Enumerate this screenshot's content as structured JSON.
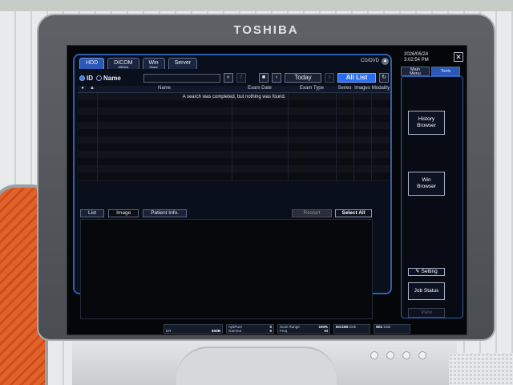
{
  "monitor": {
    "brand": "TOSHIBA"
  },
  "tabs": [
    {
      "label": "HDD",
      "active": true
    },
    {
      "label": "DICOM",
      "sub": "MEDIA"
    },
    {
      "label": "Win",
      "sub": "Share"
    },
    {
      "label": "Server"
    }
  ],
  "cd_label": "CD/DVD",
  "search": {
    "id_label": "ID",
    "name_label": "Name",
    "today_label": "Today",
    "all_list_label": "All List"
  },
  "list": {
    "columns": [
      "Name",
      "Exam Date",
      "Exam Type",
      "Series",
      "Images",
      "Modality"
    ],
    "message": "A search was completed, but nothing was found."
  },
  "lower": {
    "tabs": [
      "List",
      "Image",
      "Patient Info."
    ],
    "restart_label": "Restart",
    "select_all_label": "Select All"
  },
  "side": {
    "date": "2026/06/24",
    "time": "3:02:54 PM",
    "tab_main_line1": "Main",
    "tab_main_line2": "Menu",
    "tab_tools": "Tools",
    "history_line1": "History",
    "history_line2": "Browser",
    "win_line1": "Win",
    "win_line2": "Browser",
    "setting": "Setting",
    "job_line1": "Job Status",
    "view": "View"
  },
  "status": {
    "dr": "DR",
    "dr_val": "60dB",
    "apli": "ApliPure",
    "apli_val": "0",
    "gamma": "Gamma",
    "gamma_val": "0",
    "scan_range": "Scan Range",
    "scan_val": "100%",
    "freq": "Freq",
    "freq_val": "Hi",
    "dicom": "DICOM",
    "dicom_sub": "Disk",
    "win": "Win",
    "win_sub": "Disk"
  }
}
